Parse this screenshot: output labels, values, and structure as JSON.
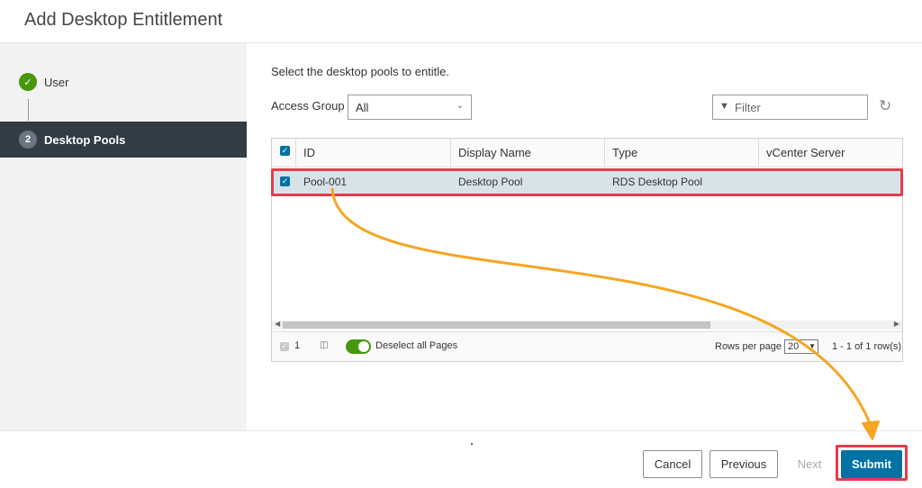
{
  "header": {
    "title": "Add Desktop Entitlement"
  },
  "wizard": {
    "steps": [
      {
        "badge": "✓",
        "label": "User"
      },
      {
        "badge": "2",
        "label": "Desktop Pools"
      }
    ]
  },
  "content": {
    "instruction": "Select the desktop pools to entitle.",
    "access_group": {
      "label": "Access Group",
      "value": "All"
    },
    "filter": {
      "placeholder": "Filter"
    }
  },
  "grid": {
    "columns": [
      "ID",
      "Display Name",
      "Type",
      "vCenter Server"
    ],
    "rows": [
      {
        "id": "Pool-001",
        "display_name": "Desktop Pool",
        "type": "RDS Desktop Pool",
        "vcenter_server": ""
      }
    ],
    "footer": {
      "selected_count": "1",
      "deselect_label": "Deselect all Pages",
      "rows_per_page_label": "Rows per page",
      "rows_per_page_value": "20",
      "range_text": "1 - 1 of 1 row(s)"
    }
  },
  "buttons": {
    "cancel": "Cancel",
    "previous": "Previous",
    "next": "Next",
    "submit": "Submit"
  },
  "colors": {
    "accent": "#0072a3",
    "success": "#48960c",
    "highlight": "#e53c4b",
    "arrow": "#f5a623"
  }
}
